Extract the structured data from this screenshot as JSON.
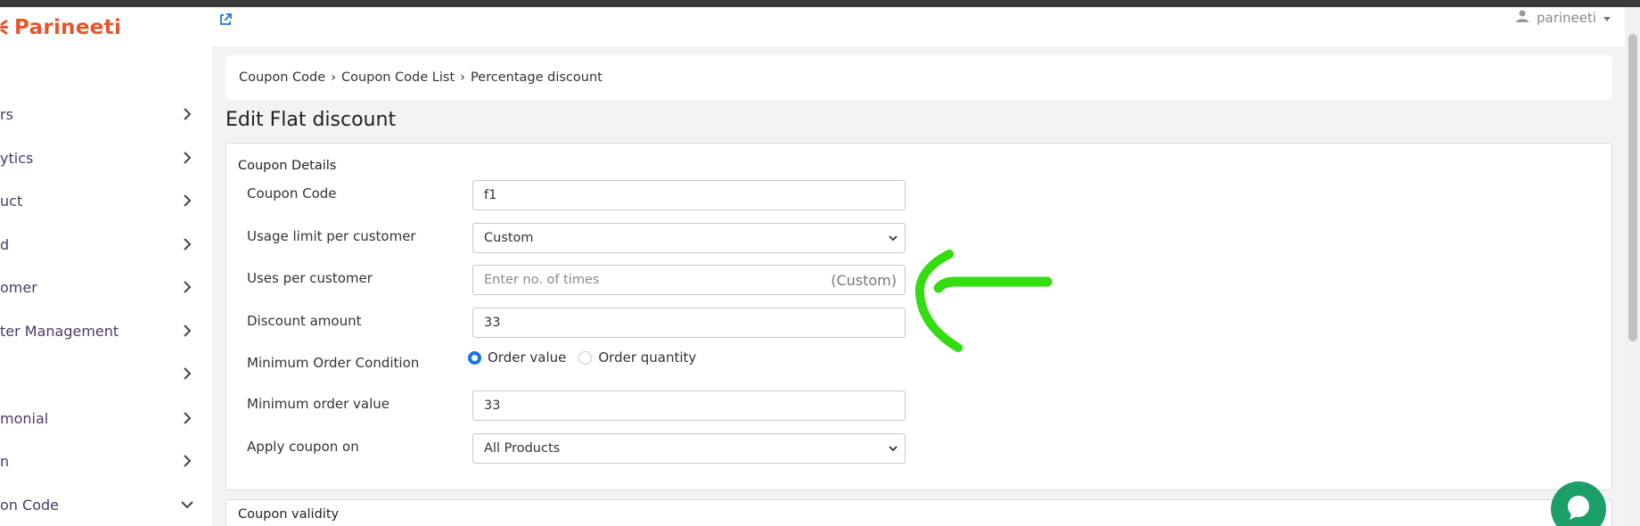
{
  "brand": {
    "name": "Parineeti",
    "color": "#e8552c"
  },
  "sidebar": {
    "items": [
      {
        "label": "rs",
        "icon": "chevron-right-icon"
      },
      {
        "label": "ytics",
        "icon": "chevron-right-icon"
      },
      {
        "label": "uct",
        "icon": "chevron-right-icon"
      },
      {
        "label": "d",
        "icon": "chevron-right-icon"
      },
      {
        "label": "omer",
        "icon": "chevron-right-icon"
      },
      {
        "label": "ter Management",
        "icon": "chevron-right-icon"
      },
      {
        "label": "",
        "icon": "chevron-right-icon"
      },
      {
        "label": "monial",
        "icon": "chevron-right-icon"
      },
      {
        "label": "n",
        "icon": "chevron-right-icon"
      },
      {
        "label": "on Code",
        "icon": "chevron-down-icon"
      }
    ]
  },
  "header": {
    "username": "parineeti",
    "user_icon": "user-icon",
    "link_icon": "external-link-icon"
  },
  "breadcrumb": [
    "Coupon Code",
    "Coupon Code List",
    "Percentage discount"
  ],
  "page_title": "Edit Flat discount",
  "coupon_details": {
    "title": "Coupon Details",
    "coupon_code": {
      "label": "Coupon Code",
      "value": "f1"
    },
    "usage_limit": {
      "label": "Usage limit per customer",
      "value": "Custom"
    },
    "uses_per_customer": {
      "label": "Uses per customer",
      "placeholder": "Enter no. of times",
      "suffix": "(Custom)"
    },
    "discount_amount": {
      "label": "Discount amount",
      "value": "33"
    },
    "min_order_condition": {
      "label": "Minimum Order Condition",
      "options": [
        "Order value",
        "Order quantity"
      ],
      "selected": "Order value"
    },
    "min_order_value": {
      "label": "Minimum order value",
      "value": "33"
    },
    "apply_on": {
      "label": "Apply coupon on",
      "value": "All Products"
    }
  },
  "coupon_validity": {
    "title": "Coupon validity"
  },
  "colors": {
    "annotation": "#33dd11",
    "radio_active": "#1a73e8",
    "chat": "#1aa066"
  }
}
